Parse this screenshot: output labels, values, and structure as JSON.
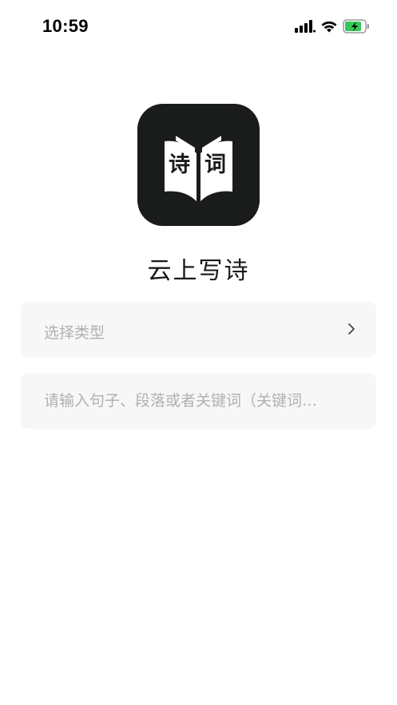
{
  "status_bar": {
    "time": "10:59",
    "icons": [
      "signal-icon",
      "wifi-icon",
      "battery-charging-icon"
    ],
    "battery_color": "#34c759"
  },
  "app": {
    "logo_chars": [
      "诗",
      "词"
    ],
    "title": "云上写诗",
    "logo_bg": "#1a1c1b"
  },
  "form": {
    "type_select": {
      "placeholder": "选择类型",
      "icon": "chevron-right-icon"
    },
    "keyword_input": {
      "placeholder": "请输入句子、段落或者关键词（关键词…"
    }
  }
}
